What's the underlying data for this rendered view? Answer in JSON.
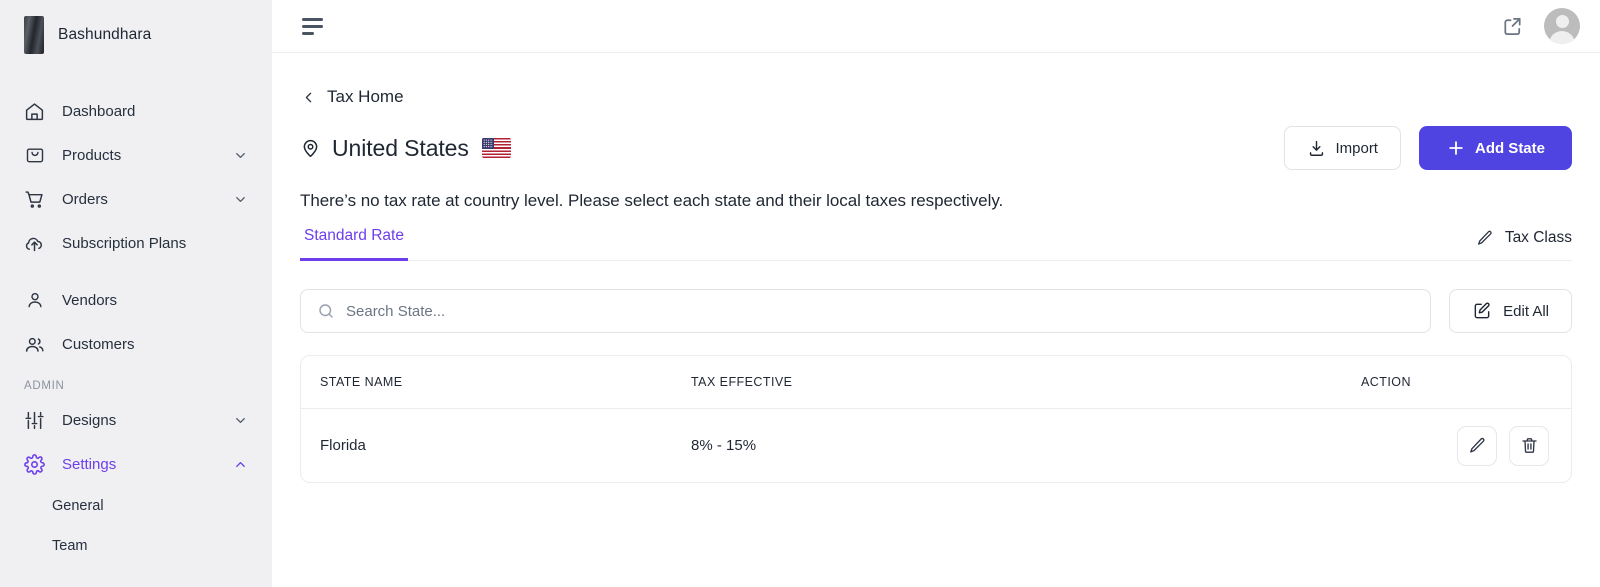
{
  "sidebar": {
    "brand": {
      "name": "Bashundhara",
      "logo_icon": "building-logo"
    },
    "items": [
      {
        "label": "Dashboard",
        "icon": "home-icon",
        "expandable": false,
        "active": false
      },
      {
        "label": "Products",
        "icon": "bag-icon",
        "expandable": true,
        "active": false
      },
      {
        "label": "Orders",
        "icon": "cart-icon",
        "expandable": true,
        "active": false
      },
      {
        "label": "Subscription Plans",
        "icon": "cloud-upload-icon",
        "expandable": false,
        "active": false
      },
      {
        "label": "Vendors",
        "icon": "user-icon",
        "expandable": false,
        "active": false
      },
      {
        "label": "Customers",
        "icon": "users-icon",
        "expandable": false,
        "active": false
      }
    ],
    "section_label": "ADMIN",
    "admin_items": [
      {
        "label": "Designs",
        "icon": "sliders-icon",
        "expandable": true,
        "active": false
      },
      {
        "label": "Settings",
        "icon": "gear-icon",
        "expandable": true,
        "active": true
      }
    ],
    "settings_children": [
      {
        "label": "General"
      },
      {
        "label": "Team"
      }
    ]
  },
  "topbar": {
    "menu_icon": "hamburger-icon",
    "external_link_icon": "external-link-icon",
    "avatar_icon": "user-avatar"
  },
  "page": {
    "breadcrumb": "Tax Home",
    "back_icon": "chevron-left-icon",
    "title": "United States",
    "title_icon": "location-pin-icon",
    "flag": "us-flag",
    "subtitle": "There’s no tax rate at country level. Please select each state and their local taxes respectively.",
    "import_label": "Import",
    "import_icon": "download-icon",
    "add_state_label": "Add State",
    "add_state_icon": "plus-icon"
  },
  "tabs": [
    {
      "label": "Standard Rate",
      "active": true
    }
  ],
  "tax_class": {
    "label": "Tax Class",
    "icon": "pencil-icon"
  },
  "search": {
    "placeholder": "Search State...",
    "value": "",
    "icon": "search-icon"
  },
  "edit_all": {
    "label": "Edit All",
    "icon": "edit-square-icon"
  },
  "table": {
    "columns": [
      "STATE NAME",
      "TAX EFFECTIVE",
      "ACTION"
    ],
    "rows": [
      {
        "state": "Florida",
        "tax_effective": "8% - 15%",
        "edit_icon": "pencil-icon",
        "delete_icon": "trash-icon"
      }
    ]
  },
  "colors": {
    "accent": "#4f43e2",
    "accent_text": "#6d3eec",
    "sidebar_bg": "#f0f0f2",
    "border": "#ececf0",
    "text": "#1f2733"
  }
}
